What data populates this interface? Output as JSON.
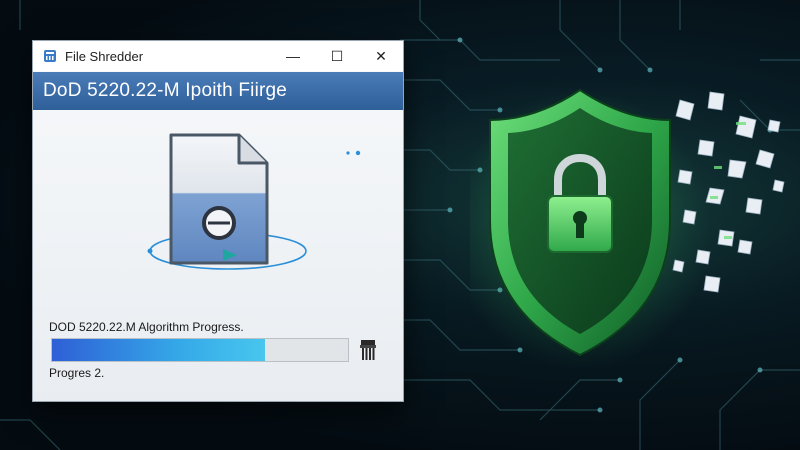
{
  "window": {
    "title": "File Shredder",
    "controls": {
      "minimize": "—",
      "maximize": "☐",
      "close": "✕"
    }
  },
  "banner": {
    "title": "DoD 5220.22-M Ipoith Fiirge"
  },
  "progress": {
    "label": "DOD 5220.22.M Algorithm Progress.",
    "value_percent": 72,
    "status": "Progres 2."
  },
  "colors": {
    "banner": "#2e5f99",
    "progress_fill": "#35a9e8",
    "shield_green": "#2fa84a",
    "background": "#07121a"
  },
  "icons": {
    "app": "file-shredder-icon",
    "file": "document-icon",
    "shred": "shredder-icon",
    "lock": "padlock-icon",
    "shield": "shield-icon"
  }
}
